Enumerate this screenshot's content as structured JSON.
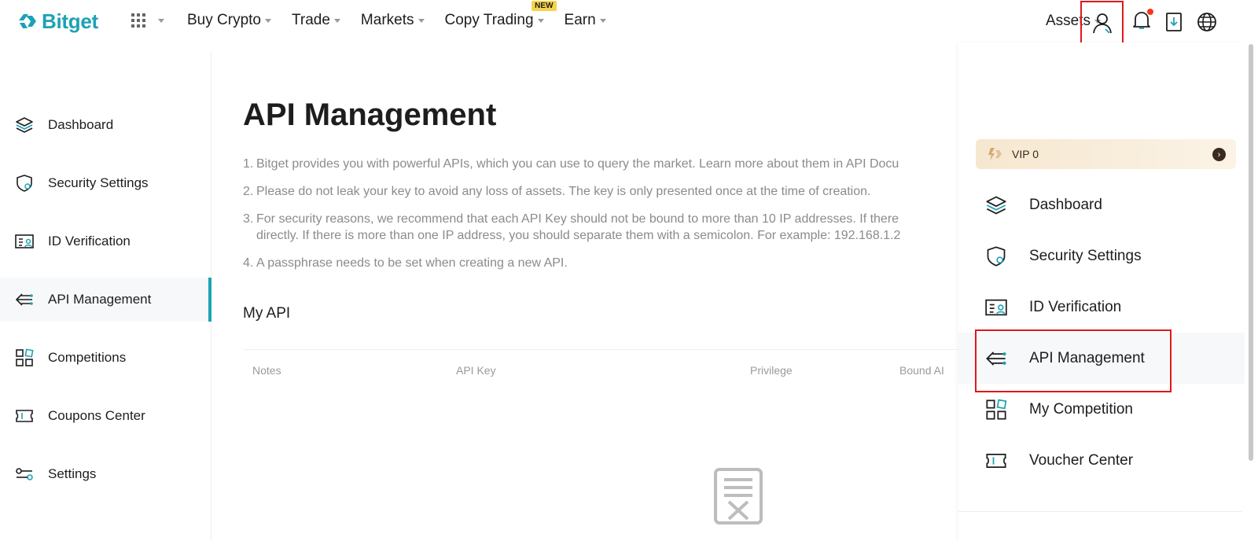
{
  "brand": {
    "name": "Bitget",
    "accent": "#1da2b4",
    "alert": "#e0181b"
  },
  "nav": {
    "items": [
      {
        "label": "Buy Crypto"
      },
      {
        "label": "Trade"
      },
      {
        "label": "Markets"
      },
      {
        "label": "Copy Trading",
        "badge": "NEW"
      },
      {
        "label": "Earn"
      }
    ],
    "assets_label": "Assets",
    "icons": [
      "apps-grid-icon",
      "user-icon",
      "bell-icon",
      "download-icon",
      "globe-icon"
    ]
  },
  "sidebar": {
    "items": [
      {
        "label": "Dashboard",
        "icon": "layers-icon"
      },
      {
        "label": "Security Settings",
        "icon": "shield-icon"
      },
      {
        "label": "ID Verification",
        "icon": "id-card-icon"
      },
      {
        "label": "API Management",
        "icon": "api-icon",
        "active": true
      },
      {
        "label": "Competitions",
        "icon": "grid-icon"
      },
      {
        "label": "Coupons Center",
        "icon": "ticket-icon"
      },
      {
        "label": "Settings",
        "icon": "sliders-icon"
      }
    ]
  },
  "main": {
    "title": "API Management",
    "notes": [
      {
        "num": "1.",
        "text": "Bitget provides you with powerful APIs, which you can use to query the market. Learn more about them in API Docu"
      },
      {
        "num": "2.",
        "text": "Please do not leak your key to avoid any loss of assets. The key is only presented once at the time of creation."
      },
      {
        "num": "3.",
        "text": "For security reasons, we recommend that each API Key should not be bound to more than 10 IP addresses. If there",
        "text2": "directly. If there is more than one IP address, you should separate them with a semicolon. For example: 192.168.1.2"
      },
      {
        "num": "4.",
        "text": "A passphrase needs to be set when creating a new API."
      }
    ],
    "my_api_title": "My API",
    "table_headers": [
      "Notes",
      "API Key",
      "Privilege",
      "Bound AI"
    ],
    "empty_icon": "empty-document-icon"
  },
  "dropdown": {
    "vip_label": "VIP 0",
    "items": [
      {
        "label": "Dashboard",
        "icon": "layers-icon"
      },
      {
        "label": "Security Settings",
        "icon": "shield-icon"
      },
      {
        "label": "ID Verification",
        "icon": "id-card-icon"
      },
      {
        "label": "API Management",
        "icon": "api-icon",
        "highlighted": true
      },
      {
        "label": "My Competition",
        "icon": "grid-icon"
      },
      {
        "label": "Voucher Center",
        "icon": "ticket-icon"
      }
    ]
  }
}
